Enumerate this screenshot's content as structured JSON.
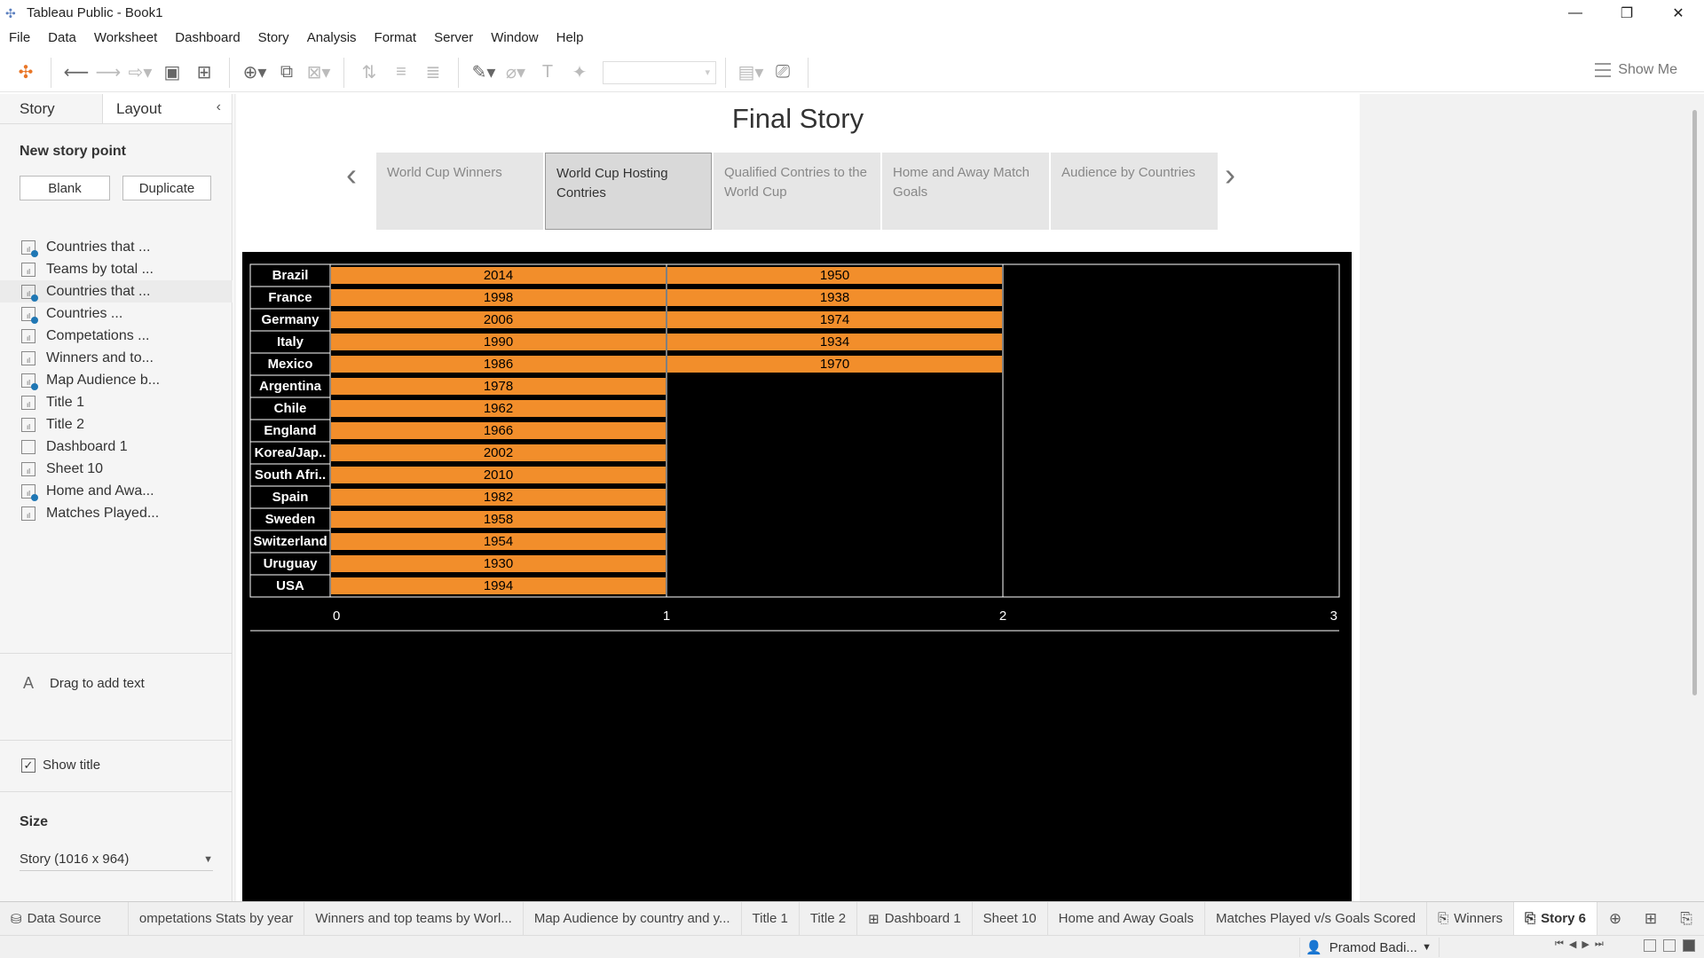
{
  "window": {
    "title": "Tableau Public - Book1"
  },
  "menu": [
    "File",
    "Data",
    "Worksheet",
    "Dashboard",
    "Story",
    "Analysis",
    "Format",
    "Server",
    "Window",
    "Help"
  ],
  "toolbar": {
    "show_me": "Show Me"
  },
  "left_panel": {
    "tabs": {
      "story": "Story",
      "layout": "Layout"
    },
    "new_story_point": "New story point",
    "blank": "Blank",
    "duplicate": "Duplicate",
    "sheets": [
      {
        "label": "Countries that ...",
        "type": "sheet-check"
      },
      {
        "label": "Teams by total ...",
        "type": "sheet"
      },
      {
        "label": "Countries that ...",
        "type": "sheet-check"
      },
      {
        "label": "Countries ...",
        "type": "sheet-check"
      },
      {
        "label": "Competations ...",
        "type": "sheet"
      },
      {
        "label": "Winners and to...",
        "type": "sheet"
      },
      {
        "label": "Map Audience b...",
        "type": "sheet-check"
      },
      {
        "label": "Title 1",
        "type": "sheet"
      },
      {
        "label": "Title 2",
        "type": "sheet"
      },
      {
        "label": "Dashboard 1",
        "type": "dashboard"
      },
      {
        "label": "Sheet 10",
        "type": "sheet"
      },
      {
        "label": "Home and Awa...",
        "type": "sheet-check"
      },
      {
        "label": "Matches Played...",
        "type": "sheet"
      }
    ],
    "drag_text": "Drag to add text",
    "show_title": "Show title",
    "size_label": "Size",
    "size_value": "Story (1016 x 964)"
  },
  "story": {
    "title": "Final Story",
    "points": [
      "World Cup Winners",
      "World Cup Hosting Contries",
      "Qualified Contries to the World Cup",
      "Home and Away Match Goals",
      "Audience by Countries"
    ],
    "active_point": 1
  },
  "chart_data": {
    "type": "bar",
    "orientation": "horizontal-stacked",
    "bar_color": "#f28e2b",
    "background": "#000000",
    "categories": [
      "Brazil",
      "France",
      "Germany",
      "Italy",
      "Mexico",
      "Argentina",
      "Chile",
      "England",
      "Korea/Jap..",
      "South Afri..",
      "Spain",
      "Sweden",
      "Switzerland",
      "Uruguay",
      "USA"
    ],
    "segments": [
      [
        "2014",
        "1950"
      ],
      [
        "1998",
        "1938"
      ],
      [
        "2006",
        "1974"
      ],
      [
        "1990",
        "1934"
      ],
      [
        "1986",
        "1970"
      ],
      [
        "1978"
      ],
      [
        "1962"
      ],
      [
        "1966"
      ],
      [
        "2002"
      ],
      [
        "2010"
      ],
      [
        "1982"
      ],
      [
        "1958"
      ],
      [
        "1954"
      ],
      [
        "1930"
      ],
      [
        "1994"
      ]
    ],
    "values": [
      2,
      2,
      2,
      2,
      2,
      1,
      1,
      1,
      1,
      1,
      1,
      1,
      1,
      1,
      1
    ],
    "x_ticks": [
      "0",
      "1",
      "2",
      "3"
    ],
    "xlim": [
      0,
      3
    ],
    "grid": true
  },
  "bottom_tabs": [
    "Data Source",
    "ompetations Stats by year",
    "Winners and top teams by Worl...",
    "Map Audience by country and y...",
    "Title 1",
    "Title 2",
    "Dashboard 1",
    "Sheet 10",
    "Home and Away Goals",
    "Matches Played v/s Goals Scored",
    "Winners",
    "Story 6"
  ],
  "status": {
    "user": "Pramod Badi..."
  }
}
